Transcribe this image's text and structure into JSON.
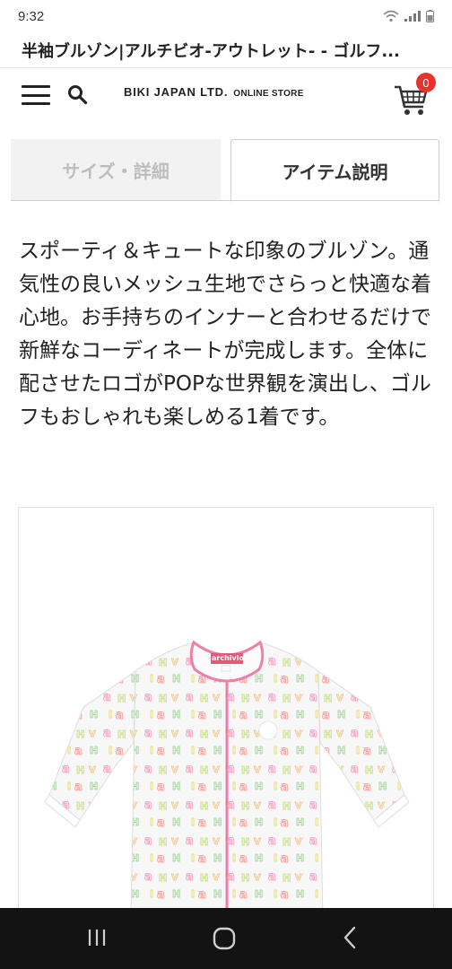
{
  "status": {
    "time": "9:32"
  },
  "page": {
    "title": "半袖ブルゾン|アルチビオ-アウトレット- - ゴルフ..."
  },
  "header": {
    "brand": "BIKI JAPAN LTD.",
    "brand_sub": "ONLINE STORE",
    "cart_count": "0",
    "menu_icon": "hamburger-menu-icon",
    "search_icon": "search-icon",
    "cart_icon": "shopping-cart-icon"
  },
  "tabs": [
    {
      "label": "サイズ・詳細",
      "active": false
    },
    {
      "label": "アイテム説明",
      "active": true
    }
  ],
  "description": {
    "text": "スポーティ＆キュートな印象のブルゾン。通気性の良いメッシュ生地でさらっと快適な着心地。お手持ちのインナーと合わせるだけで新鮮なコーディネートが完成します。全体に配させたロゴがPOPな世界観を演出し、ゴルフもおしゃれも楽しめる1着です。"
  },
  "product": {
    "tag_text": "archivio",
    "image": "short-sleeve-blouson-with-colorful-logo-print"
  },
  "colors": {
    "accent": "#e8332c",
    "tab_inactive_bg": "#f2f2f2",
    "tab_inactive_text": "#bdbdbd",
    "trim_pink": "#ee7fa6",
    "nav_bg": "#131313"
  },
  "system_nav": [
    "recent-apps-icon",
    "home-icon",
    "back-icon"
  ]
}
